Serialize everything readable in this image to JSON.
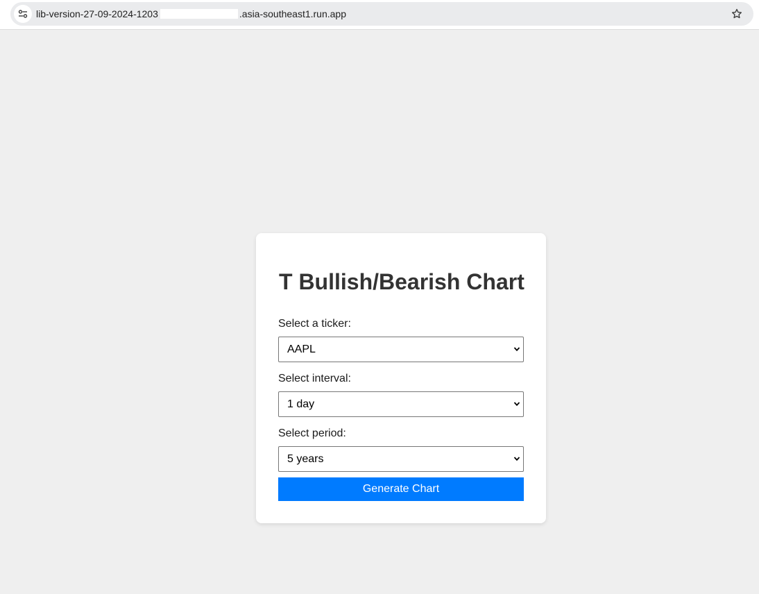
{
  "browser": {
    "url_prefix": "lib-version-27-09-2024-1203",
    "url_suffix": ".asia-southeast1.run.app",
    "site_info_icon": "tune-icon",
    "bookmark_icon": "star-icon"
  },
  "form": {
    "title": "T Bullish/Bearish Chart",
    "ticker": {
      "label": "Select a ticker:",
      "value": "AAPL"
    },
    "interval": {
      "label": "Select interval:",
      "value": "1 day"
    },
    "period": {
      "label": "Select period:",
      "value": "5 years"
    },
    "submit_label": "Generate Chart"
  },
  "colors": {
    "accent": "#007bff",
    "background": "#efefef",
    "title": "#333333"
  }
}
